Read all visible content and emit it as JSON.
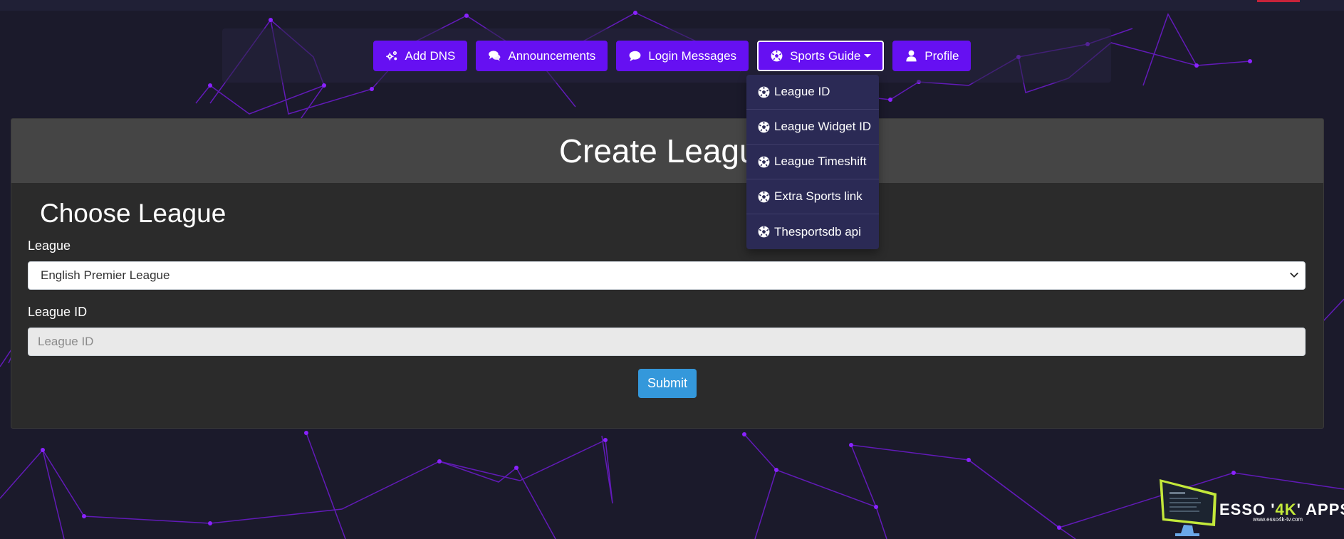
{
  "nav": {
    "add_dns": "Add DNS",
    "announcements": "Announcements",
    "login_messages": "Login Messages",
    "sports_guide": "Sports Guide",
    "profile": "Profile"
  },
  "dropdown": {
    "items": [
      "League ID",
      "League Widget ID",
      "League Timeshift",
      "Extra Sports link",
      "Thesportsdb api"
    ]
  },
  "card": {
    "title": "Create League",
    "section_title": "Choose League",
    "league_label": "League",
    "league_value": "English Premier League",
    "league_id_label": "League ID",
    "league_id_placeholder": "League ID",
    "submit_label": "Submit"
  },
  "brand": {
    "name_prefix": "ESSO '",
    "name_accent": "4K",
    "name_suffix": "' APPS",
    "url": "www.esso4k-tv.com"
  },
  "colors": {
    "nav_button": "#6610f2",
    "dropdown_bg": "#2b2a55",
    "submit_button": "#3498db",
    "card_header": "#454545",
    "card_body": "#2b2b2b",
    "page_bg": "#1b1a2b"
  },
  "icons": {
    "add_dns": "cogs-icon",
    "announcements": "comments-icon",
    "login_messages": "comment-icon",
    "sports_guide": "futbol-icon",
    "profile": "user-icon",
    "dropdown_item": "futbol-icon",
    "select": "chevron-down-icon"
  }
}
